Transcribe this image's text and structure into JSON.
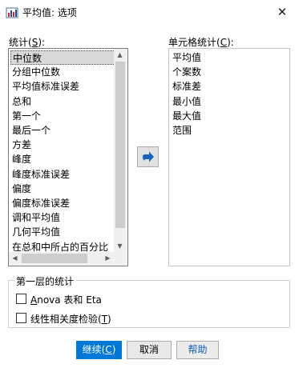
{
  "window": {
    "title": "平均值: 选项",
    "close_glyph": "✕"
  },
  "statistics": {
    "label_prefix": "统计(",
    "label_key": "S",
    "label_suffix": "):",
    "items": [
      "中位数",
      "分组中位数",
      "平均值标准误差",
      "总和",
      "第一个",
      "最后一个",
      "方差",
      "峰度",
      "峰度标准误差",
      "偏度",
      "偏度标准误差",
      "调和平均值",
      "几何平均值",
      "在总和中所占的百分比"
    ],
    "selected_index": 0
  },
  "cell_statistics": {
    "label_prefix": "单元格统计(",
    "label_key": "C",
    "label_suffix": "):",
    "items": [
      "平均值",
      "个案数",
      "标准差",
      "最小值",
      "最大值",
      "范围"
    ]
  },
  "first_layer": {
    "title": "第一层的统计",
    "anova_key": "A",
    "anova_rest": "nova 表和 Eta",
    "linearity_prefix": "线性相关度检验(",
    "linearity_key": "T",
    "linearity_suffix": ")"
  },
  "buttons": {
    "continue_prefix": "继续(",
    "continue_key": "C",
    "continue_suffix": ")",
    "cancel": "取消",
    "help": "帮助"
  },
  "colors": {
    "primary": "#0078d7",
    "arrow_blue": "#1565c0",
    "help_text": "#0e5fb8"
  }
}
